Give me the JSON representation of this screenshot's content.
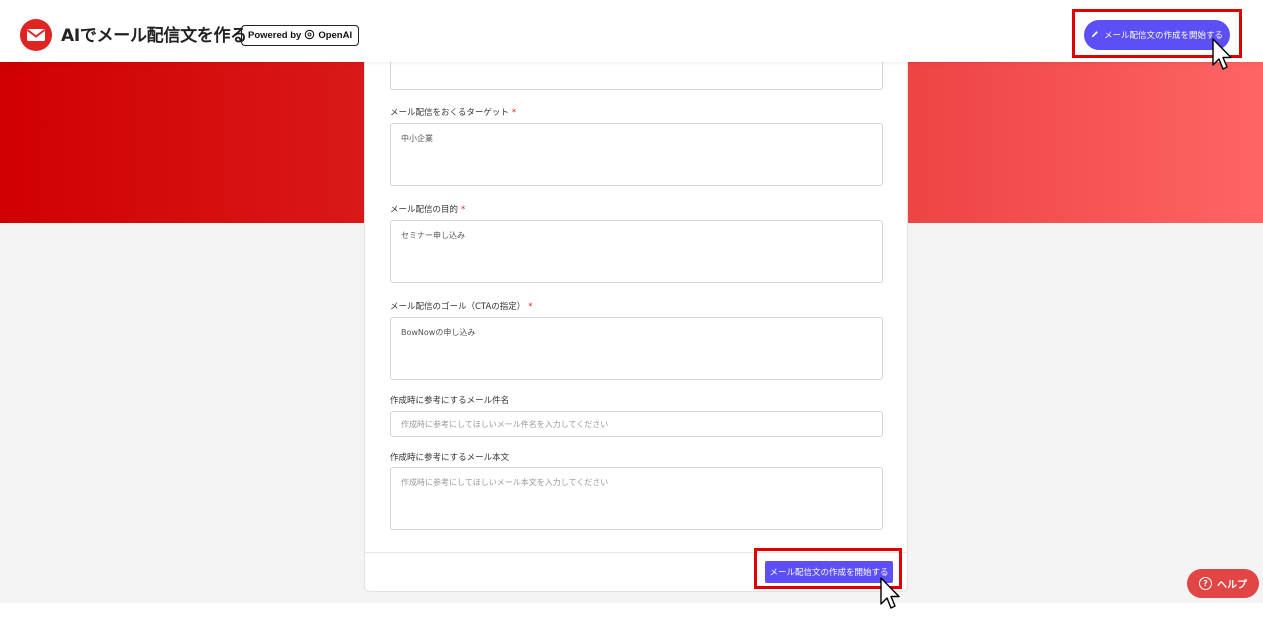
{
  "header": {
    "title": "AIでメール配信文を作る",
    "powered_by": "Powered by",
    "powered_brand": "OpenAI",
    "start_button": "メール配信文の作成を開始する"
  },
  "form": {
    "target": {
      "label": "メール配信をおくるターゲット",
      "required": "*",
      "value": "中小企業"
    },
    "purpose": {
      "label": "メール配信の目的",
      "required": "*",
      "value": "セミナー申し込み"
    },
    "goal": {
      "label": "メール配信のゴール（CTAの指定）",
      "required": "*",
      "value": "BowNowの申し込み"
    },
    "ref_subject": {
      "label": "作成時に参考にするメール件名",
      "placeholder": "作成時に参考にしてほしいメール件名を入力してください"
    },
    "ref_body": {
      "label": "作成時に参考にするメール本文",
      "placeholder": "作成時に参考にしてほしいメール本文を入力してください"
    },
    "submit_button": "メール配信文の作成を開始する"
  },
  "help": {
    "label": "ヘルプ",
    "icon": "?"
  },
  "colors": {
    "accent": "#5b4ff5",
    "brand_red": "#e02424",
    "highlight": "#e00000"
  }
}
